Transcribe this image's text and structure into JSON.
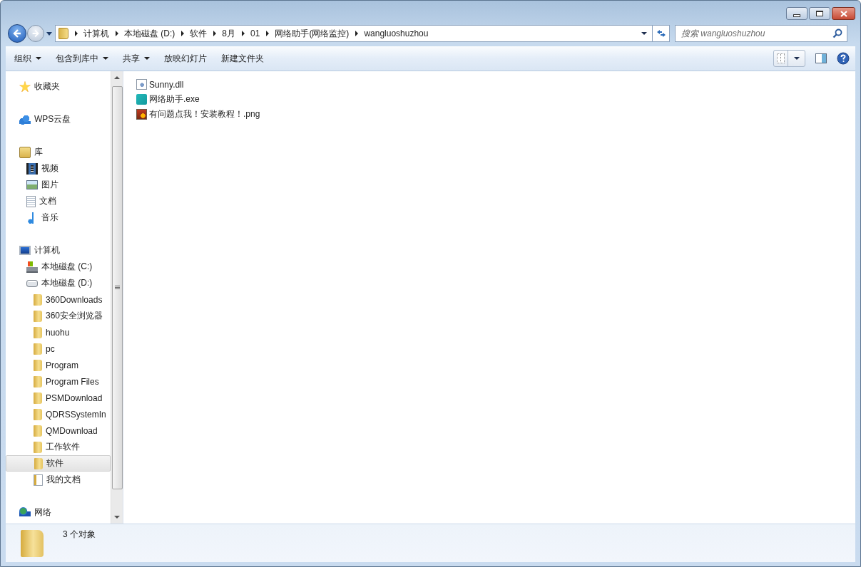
{
  "address_bar": {
    "segments": [
      "计算机",
      "本地磁盘 (D:)",
      "软件",
      "8月",
      "01",
      "网络助手(网络监控)",
      "wangluoshuzhou"
    ]
  },
  "search": {
    "placeholder": "搜索 wangluoshuzhou"
  },
  "toolbar": [
    {
      "label": "组织",
      "dropdown": true
    },
    {
      "label": "包含到库中",
      "dropdown": true
    },
    {
      "label": "共享",
      "dropdown": true
    },
    {
      "label": "放映幻灯片",
      "dropdown": false
    },
    {
      "label": "新建文件夹",
      "dropdown": false
    }
  ],
  "sidebar": {
    "groups": [
      {
        "label": "收藏夹",
        "kind": "favorites",
        "selected": false
      },
      {
        "label": "WPS云盘",
        "kind": "cloud",
        "selected": false
      },
      {
        "label": "库",
        "kind": "library",
        "selected": false,
        "children": [
          {
            "label": "视频",
            "kind": "video",
            "selected": false
          },
          {
            "label": "图片",
            "kind": "pictures",
            "selected": false
          },
          {
            "label": "文档",
            "kind": "documents",
            "selected": false
          },
          {
            "label": "音乐",
            "kind": "music",
            "selected": false
          }
        ]
      },
      {
        "label": "计算机",
        "kind": "computer",
        "selected": false,
        "children": [
          {
            "label": "本地磁盘 (C:)",
            "kind": "system-drive",
            "selected": false
          },
          {
            "label": "本地磁盘 (D:)",
            "kind": "drive",
            "selected": false,
            "children": [
              {
                "label": "360Downloads",
                "kind": "folder",
                "selected": false
              },
              {
                "label": "360安全浏览器",
                "kind": "folder",
                "selected": false
              },
              {
                "label": "huohu",
                "kind": "folder",
                "selected": false
              },
              {
                "label": "pc",
                "kind": "folder",
                "selected": false
              },
              {
                "label": "Program",
                "kind": "folder",
                "selected": false
              },
              {
                "label": "Program Files",
                "kind": "folder",
                "selected": false
              },
              {
                "label": "PSMDownload",
                "kind": "folder",
                "selected": false
              },
              {
                "label": "QDRSSystemIn",
                "kind": "folder",
                "selected": false
              },
              {
                "label": "QMDownload",
                "kind": "folder",
                "selected": false
              },
              {
                "label": "工作软件",
                "kind": "folder",
                "selected": false
              },
              {
                "label": "软件",
                "kind": "folder",
                "selected": true
              },
              {
                "label": "我的文档",
                "kind": "doc-folder",
                "selected": false
              }
            ]
          }
        ]
      },
      {
        "label": "网络",
        "kind": "network",
        "selected": false
      }
    ]
  },
  "files": [
    {
      "name": "Sunny.dll",
      "kind": "dll"
    },
    {
      "name": "网络助手.exe",
      "kind": "app"
    },
    {
      "name": "有问题点我！安装教程！.png",
      "kind": "image"
    }
  ],
  "status_bar": {
    "count": "3 个对象"
  }
}
